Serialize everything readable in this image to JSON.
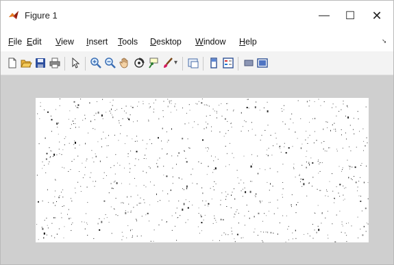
{
  "window": {
    "title": "Figure 1",
    "controls": {
      "minimize": "—",
      "maximize": "☐",
      "close": "✕"
    }
  },
  "menubar": {
    "items": [
      "File",
      "Edit",
      "View",
      "Insert",
      "Tools",
      "Desktop",
      "Window",
      "Help"
    ],
    "overflow_arrow": "➘"
  },
  "toolbar": {
    "tools": [
      "new-figure-icon",
      "open-file-icon",
      "save-icon",
      "print-icon",
      "pointer-icon",
      "zoom-in-icon",
      "zoom-out-icon",
      "pan-hand-icon",
      "rotate-3d-icon",
      "data-cursor-icon",
      "brush-icon",
      "brush-dropdown-icon",
      "link-plot-icon",
      "colorbar-icon",
      "legend-icon",
      "hide-plot-tools-icon",
      "show-plot-tools-icon"
    ]
  },
  "colors": {
    "titlebar": "#ffffff",
    "canvas_background": "#cfcfcf",
    "axes_background": "#ffffff",
    "dots": "#000000"
  }
}
